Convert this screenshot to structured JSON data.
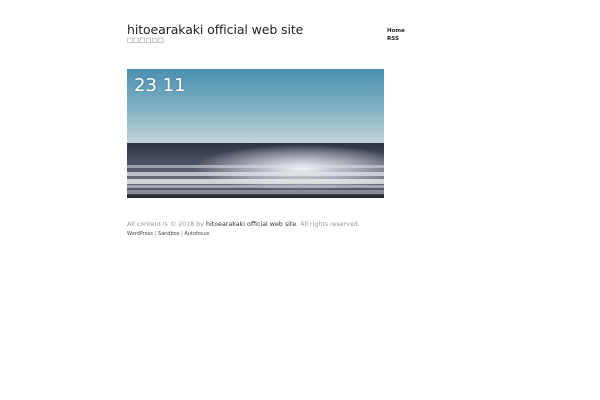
{
  "header": {
    "site_title": "hitoearakaki official web site",
    "site_description": "□□□□□□"
  },
  "nav": {
    "items": [
      {
        "label": "Home"
      },
      {
        "label": "RSS"
      }
    ]
  },
  "post": {
    "date_label": "23 11 "
  },
  "footer": {
    "prefix": "All content is © 2018 by ",
    "site_link": "hitoearakaki official web site",
    "suffix": ". All rights reserved.",
    "credits": [
      {
        "label": "WordPress"
      },
      {
        "label": "Sandbox"
      },
      {
        "label": "Autofocus"
      }
    ],
    "separator": " | "
  },
  "colors": {
    "title": "#222222",
    "muted": "#999999",
    "sky_top": "#4f96b5",
    "sky_bottom": "#b6ced7",
    "sea": "#3a3f4d"
  }
}
